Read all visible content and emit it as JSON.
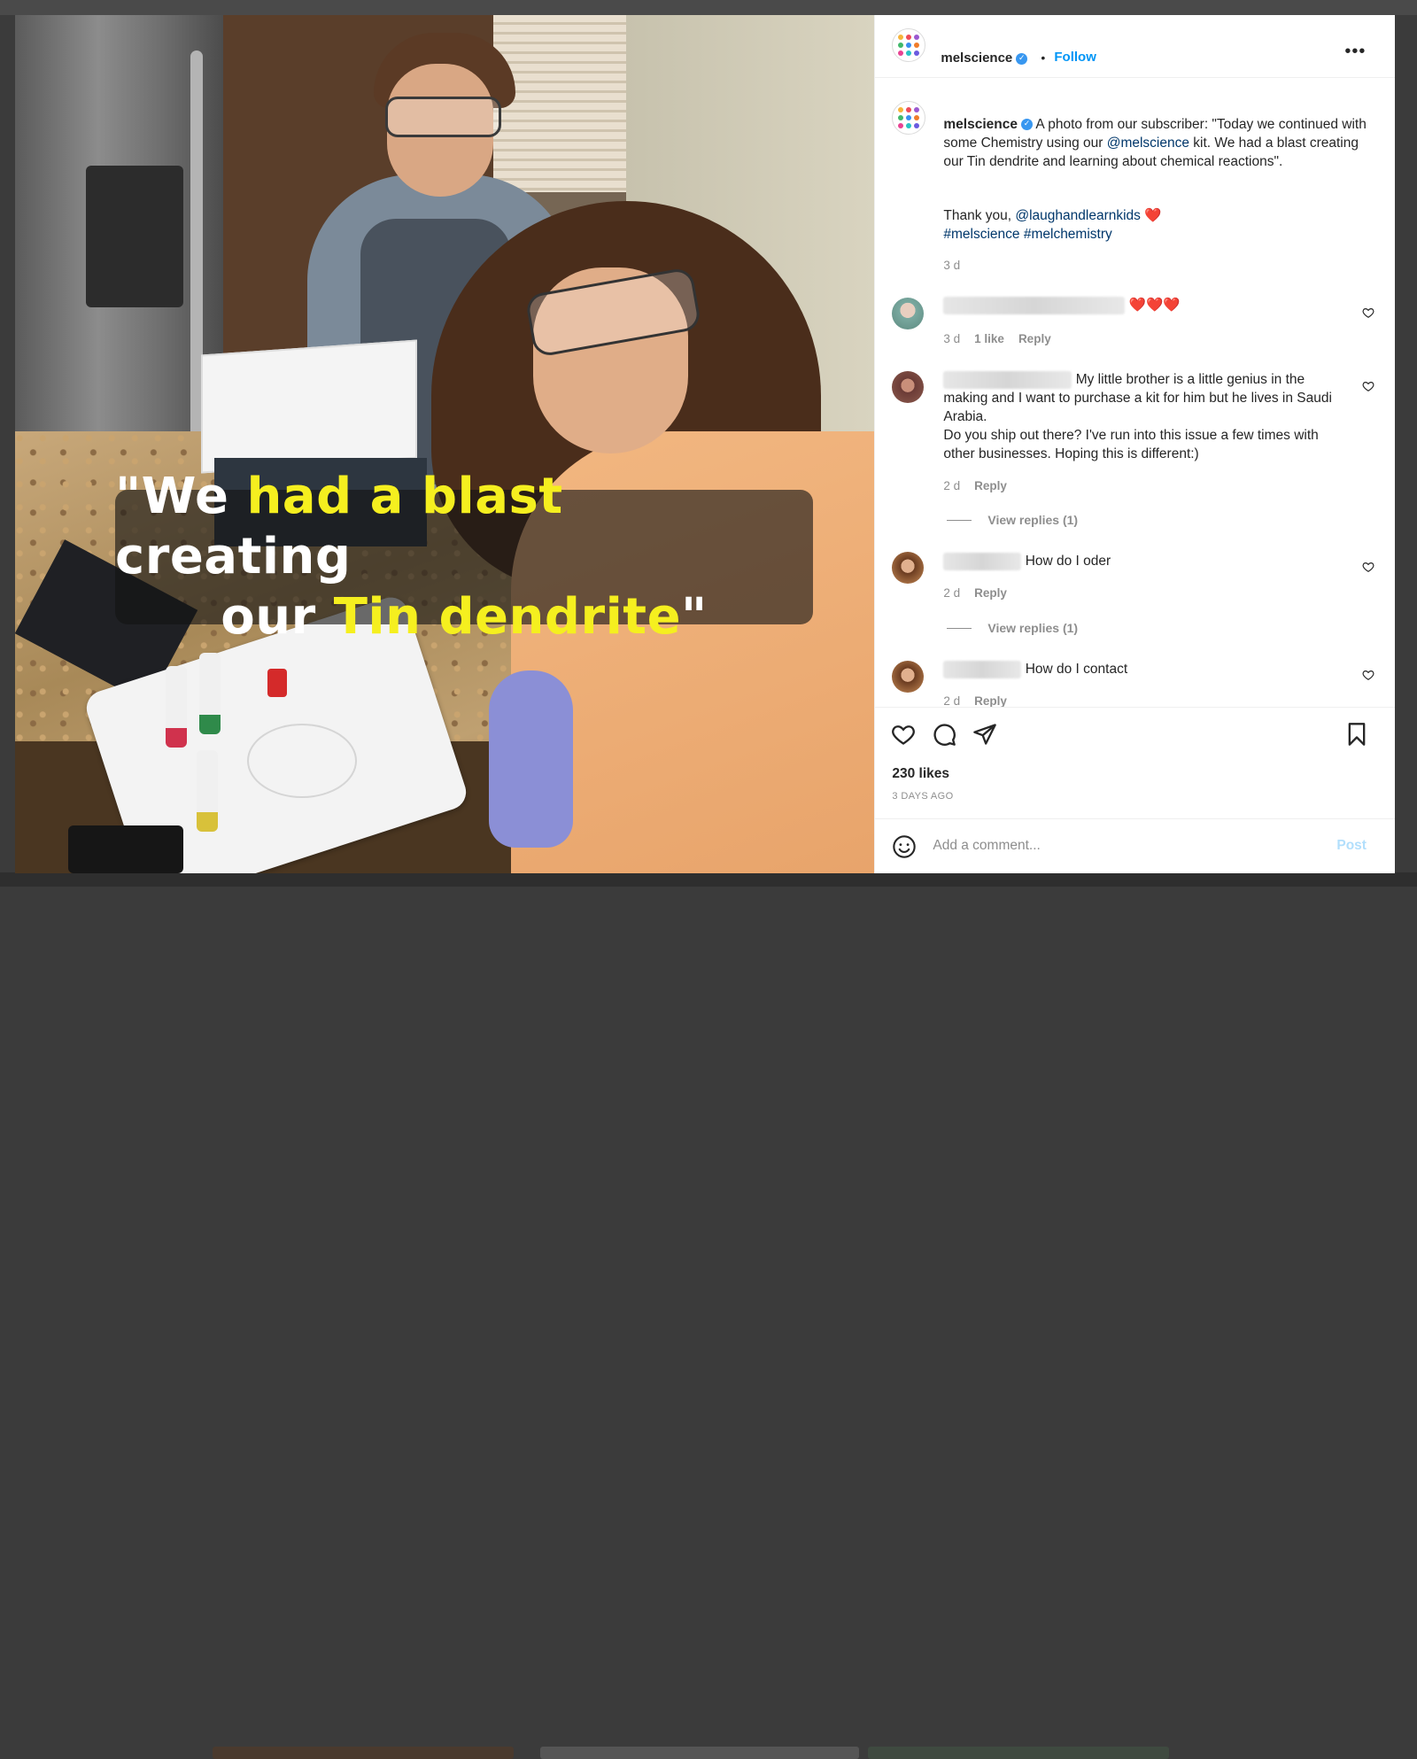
{
  "post": {
    "username": "melscience",
    "verified_mark": "✓",
    "follow_label": "Follow",
    "separator": "•",
    "more_label": "•••",
    "image_caption": {
      "line1_prefix": "\"We ",
      "line1_highlight": "had a blast",
      "line1_suffix": " creating",
      "line2_prefix": "our ",
      "line2_highlight": "Tin dendrite",
      "line2_suffix": "\""
    }
  },
  "caption": {
    "username": "melscience",
    "text_before_mention": "A photo from our subscriber: \"Today we continued with some Chemistry using our ",
    "mention": "@melscience",
    "text_after_mention": " kit. We had a blast creating our Tin dendrite and learning about chemical reactions\".",
    "thanks_text": "Thank you, ",
    "thanks_mention": "@laughandlearnkids",
    "thanks_emoji": "❤️",
    "hashtags": [
      "#melscience",
      "#melchemistry"
    ],
    "time": "3 d"
  },
  "comments": [
    {
      "text": "❤️❤️❤️",
      "time": "3 d",
      "likes": "1 like",
      "reply_label": "Reply",
      "avatar_icon": "user-avatar-1"
    },
    {
      "text_line1": "My little brother is a little genius in the",
      "text_rest": "making and I want to purchase a kit for him but he lives in Saudi Arabia.",
      "text_line3": "Do you ship out there? I've run into this issue a few times with other businesses. Hoping this is different:)",
      "time": "2 d",
      "reply_label": "Reply",
      "view_replies": "View replies (1)",
      "avatar_icon": "user-avatar-2"
    },
    {
      "text": "How do I oder",
      "time": "2 d",
      "reply_label": "Reply",
      "view_replies": "View replies (1)",
      "avatar_icon": "user-avatar-3"
    },
    {
      "text": "How do I contact",
      "time": "2 d",
      "reply_label": "Reply",
      "avatar_icon": "user-avatar-4"
    }
  ],
  "actions": {
    "likes": "230 likes",
    "posted": "3 DAYS AGO",
    "add_comment_placeholder": "Add a comment...",
    "post_label": "Post"
  },
  "colors": {
    "link": "#00376b",
    "follow": "#0095f6",
    "caption_highlight": "#f5ef1f",
    "heart": "#ed4956"
  }
}
